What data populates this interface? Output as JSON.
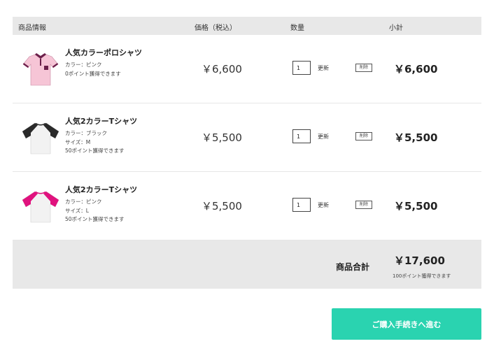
{
  "table": {
    "headers": {
      "product": "商品情報",
      "price": "価格（税込）",
      "quantity": "数量",
      "subtotal": "小計"
    },
    "items": [
      {
        "name": "人気カラーポロシャツ",
        "details": [
          "カラー：ピンク",
          "0ポイント獲得できます"
        ],
        "price": "￥6,600",
        "quantity": "1",
        "update": "更新",
        "remove": "削除",
        "subtotal": "￥6,600",
        "image_icon": "pink-polo-shirt-icon",
        "colors": {
          "body": "#f6c5d6",
          "accent": "#6b1f4a"
        }
      },
      {
        "name": "人気2カラーTシャツ",
        "details": [
          "カラー：ブラック",
          "サイズ：M",
          "50ポイント獲得できます"
        ],
        "price": "￥5,500",
        "quantity": "1",
        "update": "更新",
        "remove": "削除",
        "subtotal": "￥5,500",
        "image_icon": "black-raglan-tshirt-icon",
        "colors": {
          "body": "#f2f2f2",
          "accent": "#2a2a2a"
        }
      },
      {
        "name": "人気2カラーTシャツ",
        "details": [
          "カラー：ピンク",
          "サイズ：L",
          "50ポイント獲得できます"
        ],
        "price": "￥5,500",
        "quantity": "1",
        "update": "更新",
        "remove": "削除",
        "subtotal": "￥5,500",
        "image_icon": "pink-raglan-tshirt-icon",
        "colors": {
          "body": "#f2f2f2",
          "accent": "#e0127e"
        }
      }
    ]
  },
  "summary": {
    "label": "商品合計",
    "total": "￥17,600",
    "points": "100ポイント獲得できます"
  },
  "checkout_button": "ご購入手続きへ進む",
  "colors": {
    "header_bg": "#e8e8e8",
    "checkout_bg": "#2ad3b0"
  }
}
